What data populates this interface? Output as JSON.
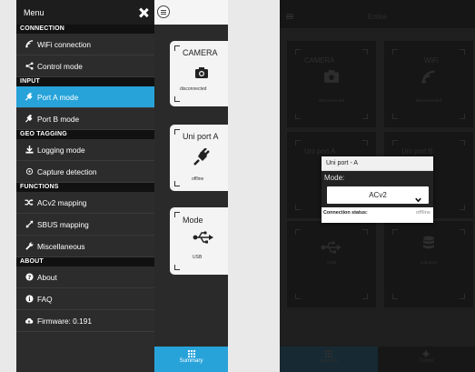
{
  "menu": {
    "title": "Menu",
    "sections": {
      "connection": "CONNECTION",
      "input": "INPUT",
      "geo": "GEO TAGGING",
      "functions": "FUNCTIONS",
      "about": "ABOUT"
    },
    "items": {
      "wifi": "WiFi connection",
      "control": "Control mode",
      "porta": "Port A mode",
      "portb": "Port B mode",
      "logging": "Logging mode",
      "capture": "Capture detection",
      "acv2": "ACv2 mapping",
      "sbus": "SBUS mapping",
      "misc": "Miscellaneous",
      "about": "About",
      "faq": "FAQ",
      "firmware": "Firmware: 0.191"
    }
  },
  "left_cards": {
    "camera": {
      "title": "CAMERA",
      "status": "disconnected"
    },
    "uniport": {
      "title": "Uni port A",
      "status": "offline"
    },
    "mode": {
      "title": "Mode",
      "status": "USB"
    }
  },
  "left_tab": {
    "summary": "Summary"
  },
  "right": {
    "title": "Entire",
    "cards": {
      "camera": {
        "title": "CAMERA",
        "status": "disconnected"
      },
      "wifi": {
        "title": "WiFi",
        "status": "disconnected"
      },
      "porta": {
        "title": "Uni port A"
      },
      "portb": {
        "title": "Uni port B"
      },
      "usb": {
        "status": "USB"
      },
      "sdcard": {
        "status": "unknown"
      }
    },
    "tabs": {
      "summary": "Summary",
      "control": "Control"
    }
  },
  "dialog": {
    "title": "Uni port - A",
    "mode_label": "Mode:",
    "mode_value": "ACv2",
    "status_label": "Connection status:",
    "status_value": "offline"
  },
  "colors": {
    "accent": "#28a3da"
  }
}
